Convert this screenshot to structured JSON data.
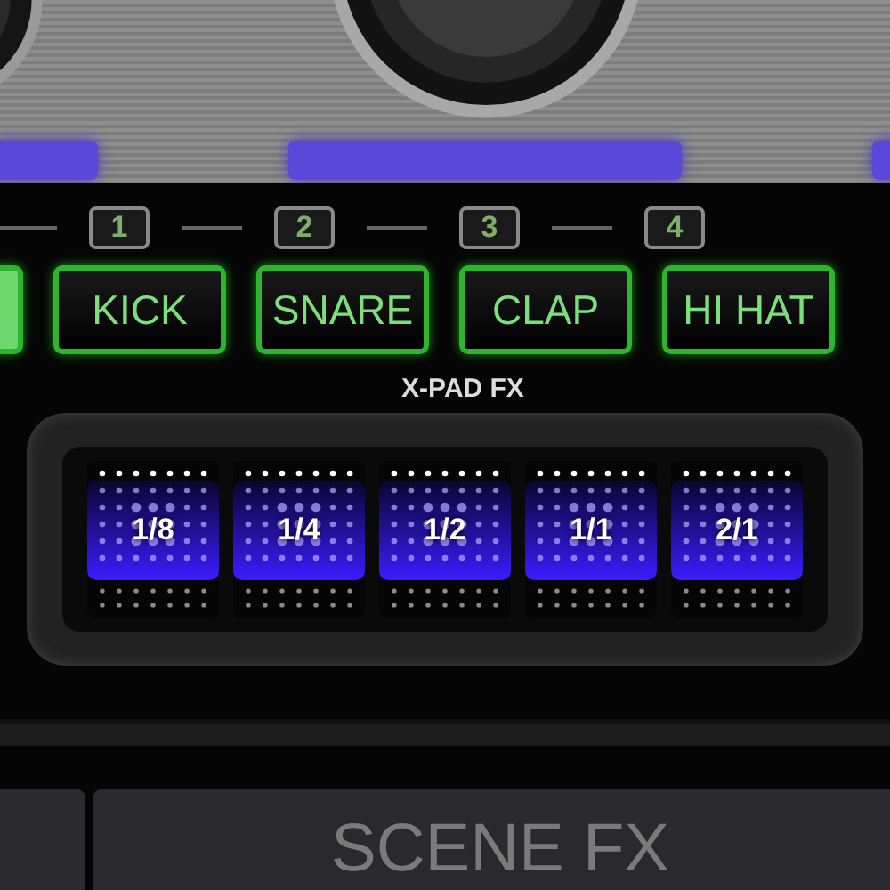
{
  "deck_strip": {
    "indicator_bars": [
      {
        "on": true
      },
      {
        "on": true
      },
      {
        "on": true
      }
    ]
  },
  "pad_numbers": [
    "1",
    "2",
    "3",
    "4"
  ],
  "sound_pads": [
    {
      "selected": true
    },
    {
      "label": "KICK",
      "selected": false
    },
    {
      "label": "SNARE",
      "selected": false
    },
    {
      "label": "CLAP",
      "selected": false
    },
    {
      "label": "HI HAT",
      "selected": false
    }
  ],
  "xpad_fx": {
    "title": "X-PAD FX",
    "pads": [
      {
        "label": "1/8",
        "selected": true
      },
      {
        "label": "1/4",
        "selected": true
      },
      {
        "label": "1/2",
        "selected": true
      },
      {
        "label": "1/1",
        "selected": true
      },
      {
        "label": "2/1",
        "selected": true
      }
    ]
  },
  "scene_fx": {
    "title": "SCENE FX"
  }
}
